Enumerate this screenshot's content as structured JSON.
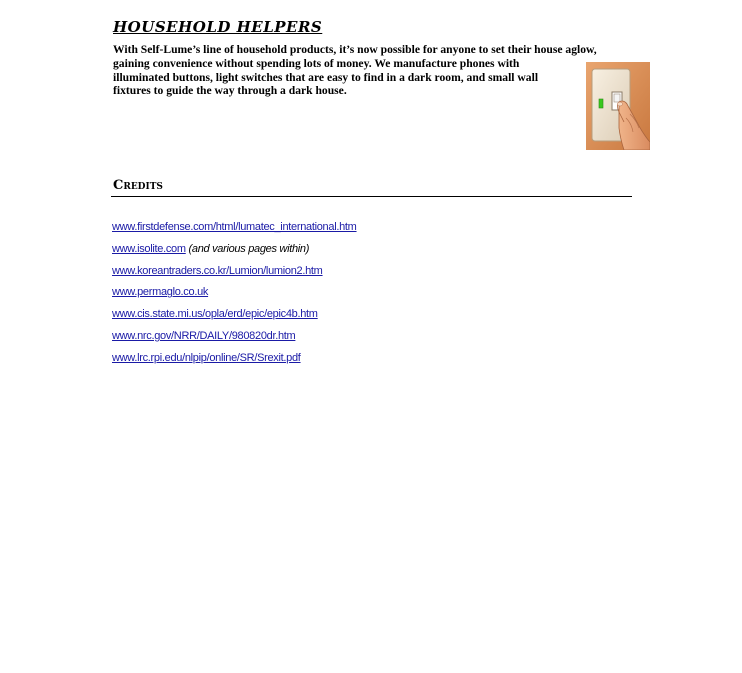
{
  "household": {
    "heading": "HOUSEHOLD HELPERS",
    "lines": [
      "With Self-Lume’s line of household products, it’s now possible for anyone to set their house aglow,",
      "gaining convenience without spending lots of money. We manufacture phones with",
      "illuminated buttons, light switches that are easy to find in a dark room, and small wall",
      "fixtures to guide the way through a dark house."
    ],
    "image": "light-switch-with-finger-illustration"
  },
  "credits": {
    "title": "Credits",
    "links": [
      {
        "url": "www.firstdefense.com/html/lumatec_international.htm",
        "note": ""
      },
      {
        "url": "www.isolite.com",
        "note": "(and various pages within)"
      },
      {
        "url": "www.koreantraders.co.kr/Lumion/lumion2.htm",
        "note": ""
      },
      {
        "url": "www.permaglo.co.uk",
        "note": ""
      },
      {
        "url": "www.cis.state.mi.us/opla/erd/epic/epic4b.htm",
        "note": ""
      },
      {
        "url": "www.nrc.gov/NRR/DAILY/980820dr.htm",
        "note": ""
      },
      {
        "url": "www.lrc.rpi.edu/nlpip/online/SR/Srexit.pdf",
        "note": ""
      }
    ]
  },
  "colors": {
    "link": "#1a1aa6",
    "text": "#000000",
    "switch_glow": "#39c81e"
  }
}
